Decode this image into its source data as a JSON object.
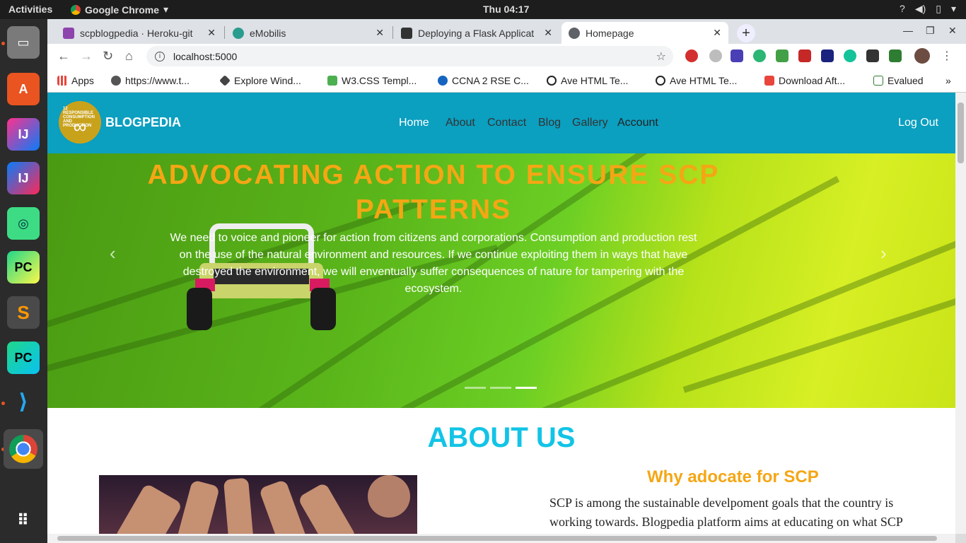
{
  "system": {
    "activities": "Activities",
    "app_name": "Google Chrome",
    "clock": "Thu 04:17"
  },
  "browser": {
    "tabs": [
      {
        "title": "scpblogpedia · Heroku-git",
        "fav_color": "#8e44ad"
      },
      {
        "title": "eMobilis",
        "fav_color": "#2a9d8f"
      },
      {
        "title": "Deploying a Flask Applicat",
        "fav_color": "#333333"
      },
      {
        "title": "Homepage",
        "fav_color": "#5f6368"
      }
    ],
    "url": "localhost:5000",
    "bookmarks": [
      {
        "label": "Apps",
        "color": "#e8453c"
      },
      {
        "label": "https://www.t...",
        "color": "#555555"
      },
      {
        "label": "Explore Wind...",
        "color": "#444444"
      },
      {
        "label": "W3.CSS Templ...",
        "color": "#4caf50"
      },
      {
        "label": "CCNA 2 RSE C...",
        "color": "#1565c0"
      },
      {
        "label": "Ave HTML Te...",
        "color": "#222222"
      },
      {
        "label": "Ave HTML Te...",
        "color": "#222222"
      },
      {
        "label": "Download Aft...",
        "color": "#e8453c"
      },
      {
        "label": "Evalued",
        "color": "#2e7d32"
      }
    ],
    "bookmarks_overflow": "»"
  },
  "site": {
    "brand": "BLOGPEDIA",
    "logo_text": "12 RESPONSIBLE CONSUMPTION AND PRODUCTION",
    "nav": {
      "home": "Home",
      "about": "About",
      "contact": "Contact",
      "blog": "Blog",
      "gallery": "Gallery",
      "account": "Account",
      "logout": "Log Out"
    },
    "hero": {
      "title": "ADVOCATING ACTION TO ENSURE SCP PATTERNS",
      "text": "We need to voice and pioneer for action from citizens and corporations. Consumption and production rest on the use of the natural environment and resources. If we continue exploiting them in ways that have destroyed the environment, we will enventually suffer consequences of nature for tampering with the ecosystem.",
      "active_slide": 3,
      "slide_count": 3
    },
    "about": {
      "heading": "ABOUT US",
      "why_title": "Why adocate for SCP",
      "why_text": "SCP is among the sustainable develpoment goals that the country is working towards. Blogpedia platform aims at educating on what SCP"
    }
  }
}
